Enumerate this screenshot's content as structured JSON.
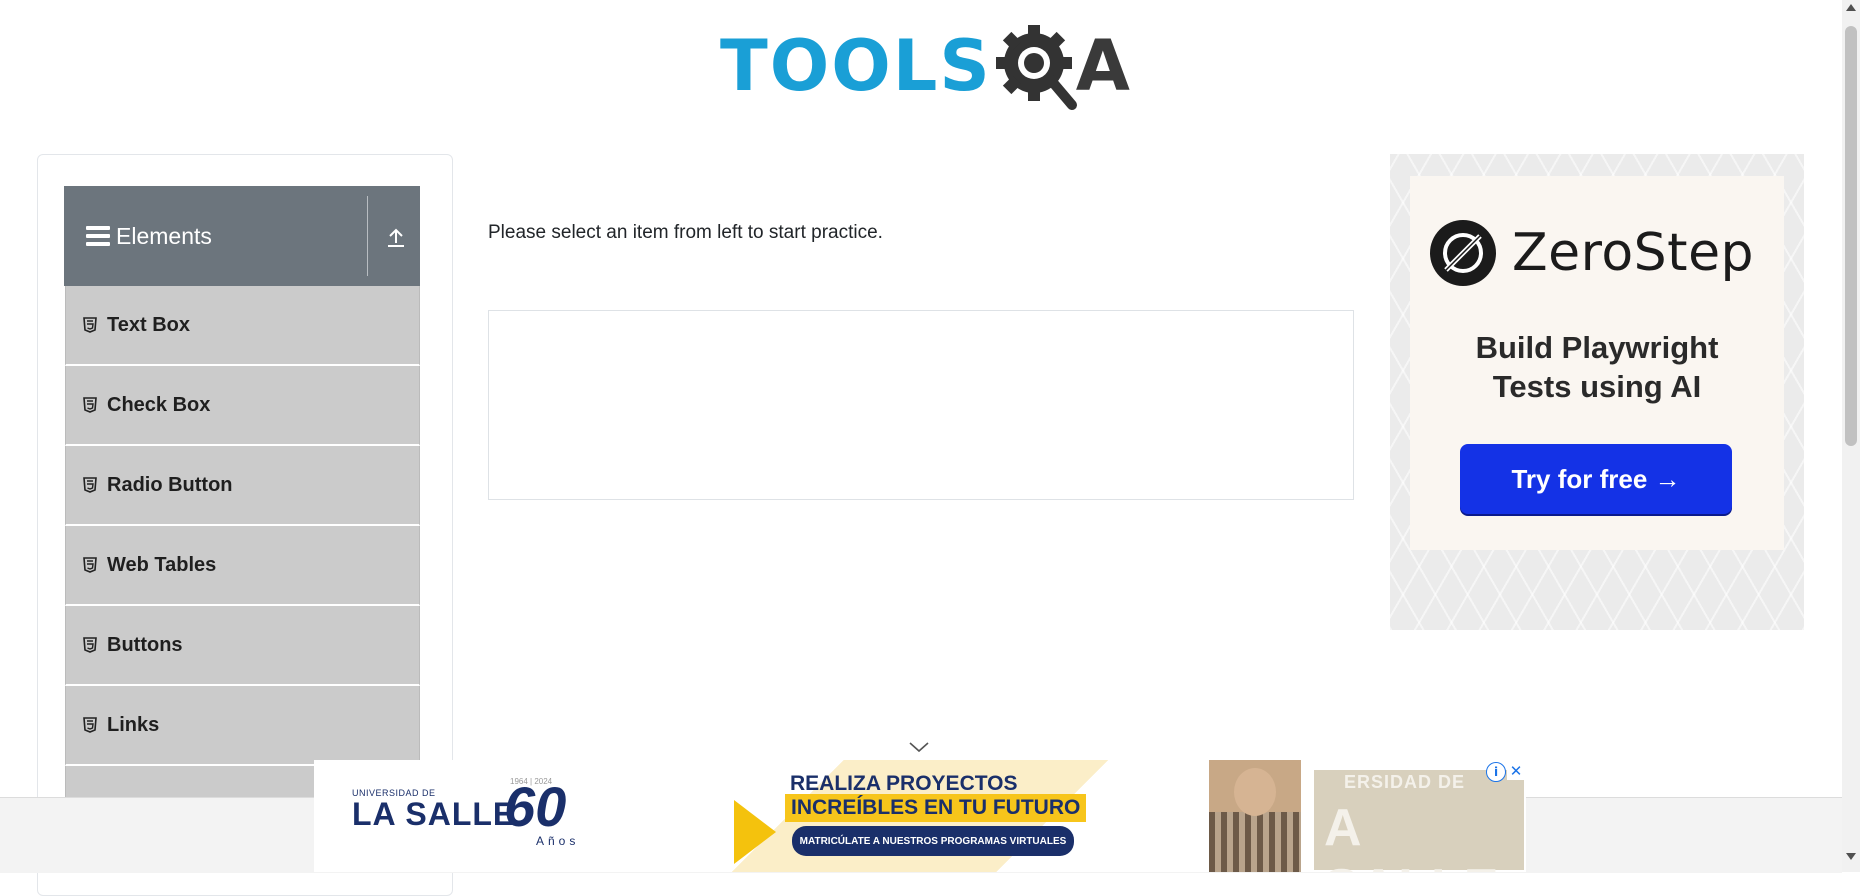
{
  "header": {
    "logo_text_blue": "TOOLS",
    "logo_text_dark": "A",
    "logo_icon": "gear-magnifier-icon"
  },
  "sidebar": {
    "group_title": "Elements",
    "menu_icon": "hamburger-icon",
    "collapse_icon": "upload-arrow-icon",
    "items": [
      {
        "label": "Text Box",
        "icon": "html5-icon"
      },
      {
        "label": "Check Box",
        "icon": "html5-icon"
      },
      {
        "label": "Radio Button",
        "icon": "html5-icon"
      },
      {
        "label": "Web Tables",
        "icon": "html5-icon"
      },
      {
        "label": "Buttons",
        "icon": "html5-icon"
      },
      {
        "label": "Links",
        "icon": "html5-icon"
      },
      {
        "label": "",
        "icon": ""
      }
    ]
  },
  "main": {
    "instruction": "Please select an item from left to start practice."
  },
  "ad_right": {
    "brand": "ZeroStep",
    "tagline_line1": "Build Playwright",
    "tagline_line2": "Tests using AI",
    "cta": "Try for free →"
  },
  "ad_bottom": {
    "university_small": "UNIVERSIDAD DE",
    "university_name": "LA SALLE",
    "years_range": "1964 | 2024",
    "anniversary": "60",
    "anos": "Años",
    "headline_line1": "REALIZA PROYECTOS",
    "headline_line2": "INCREÍBLES EN TU FUTURO",
    "cta": "MATRICÚLATE A NUESTROS PROGRAMAS VIRTUALES",
    "watermark_top": "ERSIDAD DE",
    "watermark_main": "A SALLE"
  },
  "colors": {
    "logo_blue": "#1a9fd6",
    "sidebar_header": "#6c757d",
    "menu_item_bg": "#cbcbcb",
    "ad_cta_blue": "#1432e6"
  }
}
